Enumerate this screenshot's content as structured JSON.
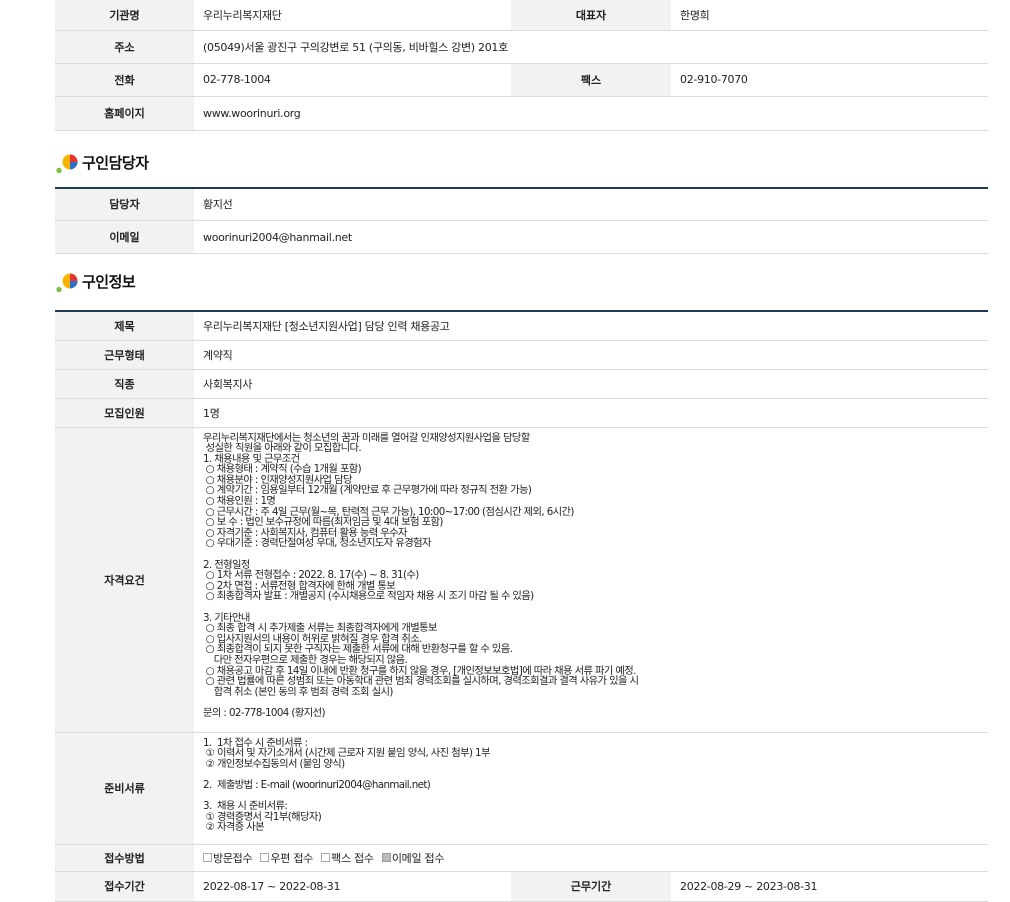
{
  "org": {
    "name_label": "기관명",
    "name_value": "우리누리복지재단",
    "ceo_label": "대표자",
    "ceo_value": "한명희",
    "address_label": "주소",
    "address_value": "(05049)서울 광진구 구의강변로 51 (구의동, 비바힐스 강변) 201호",
    "phone_label": "전화",
    "phone_value": "02-778-1004",
    "fax_label": "팩스",
    "fax_value": "02-910-7070",
    "homepage_label": "홈페이지",
    "homepage_value": "www.woorinuri.org"
  },
  "contact_section": {
    "title": "구인담당자",
    "manager_label": "담당자",
    "manager_value": "황지선",
    "email_label": "이메일",
    "email_value": "woorinuri2004@hanmail.net"
  },
  "job_section": {
    "title": "구인정보",
    "subject_label": "제목",
    "subject_value": "우리누리복지재단 [청소년지원사업] 담당 인력 채용공고",
    "worktype_label": "근무형태",
    "worktype_value": "계약직",
    "jobkind_label": "직종",
    "jobkind_value": "사회복지사",
    "headcount_label": "모집인원",
    "headcount_value": "1명",
    "qualification_label": "자격요건",
    "qualification_value": "우리누리복지재단에서는 청소년의 꿈과 미래를 열어갈 인재양성지원사업을 담당할\n 성실한 직원을 아래와 같이 모집합니다.\n1. 채용내용 및 근무조건\n ○ 채용형태 : 계약직 (수습 1개월 포함)\n ○ 채용분야 : 인재양성지원사업 담당\n ○ 계약기간 : 임용일부터 12개월 (계약만료 후 근무평가에 따라 정규직 전환 가능)\n ○ 채용인원 : 1명\n ○ 근무시간 : 주 4일 근무(월~목, 탄력적 근무 가능), 10:00~17:00 (점심시간 제외, 6시간)\n ○ 보 수 : 법인 보수규정에 따름(최저임금 및 4대 보험 포함)\n ○ 자격기준 : 사회복지사, 컴퓨터 활용 능력 우수자\n ○ 우대기준 : 경력단절여성 우대, 청소년지도자 유경험자\n\n2. 전형일정\n ○ 1차 서류 전형접수 : 2022. 8. 17(수) ~ 8. 31(수)\n ○ 2차 면접 : 서류전형 합격자에 한해 개별 통보\n ○ 최종합격자 발표 : 개별공지 (수시채용으로 적임자 채용 시 조기 마감 될 수 있음)\n\n3. 기타안내\n ○ 최종 합격 시 추가제출 서류는 최종합격자에게 개별통보\n ○ 입사지원서의 내용이 허위로 밝혀질 경우 합격 취소.\n ○ 최종합격이 되지 못한 구직자는 제출한 서류에 대해 반환청구를 할 수 있음.\n    다만 전자우편으로 제출한 경우는 해당되지 않음.\n ○ 채용공고 마감 후 14일 이내에 반환 청구를 하지 않을 경우, [개인정보보호법]에 따라 채용 서류 파기 예정.\n ○ 관련 법률에 따른 성범죄 또는 아동학대 관련 범죄 경력조회를 실시하며, 경력조회결과 결격 사유가 있을 시\n    합격 취소 (본인 동의 후 범죄 경력 조회 실시)\n\n문의 : 02-778-1004 (황지선)",
    "docs_label": "준비서류",
    "docs_value": "1.  1차 접수 시 준비서류 :\n ① 이력서 및 자기소개서 (시간제 근로자 지원 붙임 양식, 사진 첨부) 1부\n ② 개인정보수집동의서 (붙임 양식)\n\n2.  제출방법 : E-mail (woorinuri2004@hanmail.net)\n\n3.  채용 시 준비서류:\n ① 경력증명서 각1부(해당자)\n ② 자격증 사본",
    "method_label": "접수방법",
    "methods": [
      {
        "label": "방문접수",
        "checked": false
      },
      {
        "label": "우편 접수",
        "checked": false
      },
      {
        "label": "팩스 접수",
        "checked": false
      },
      {
        "label": "이메일 접수",
        "checked": true
      }
    ],
    "period_label": "접수기간",
    "period_value": "2022-08-17 ~ 2022-08-31",
    "workperiod_label": "근무기간",
    "workperiod_value": "2022-08-29 ~ 2023-08-31"
  }
}
